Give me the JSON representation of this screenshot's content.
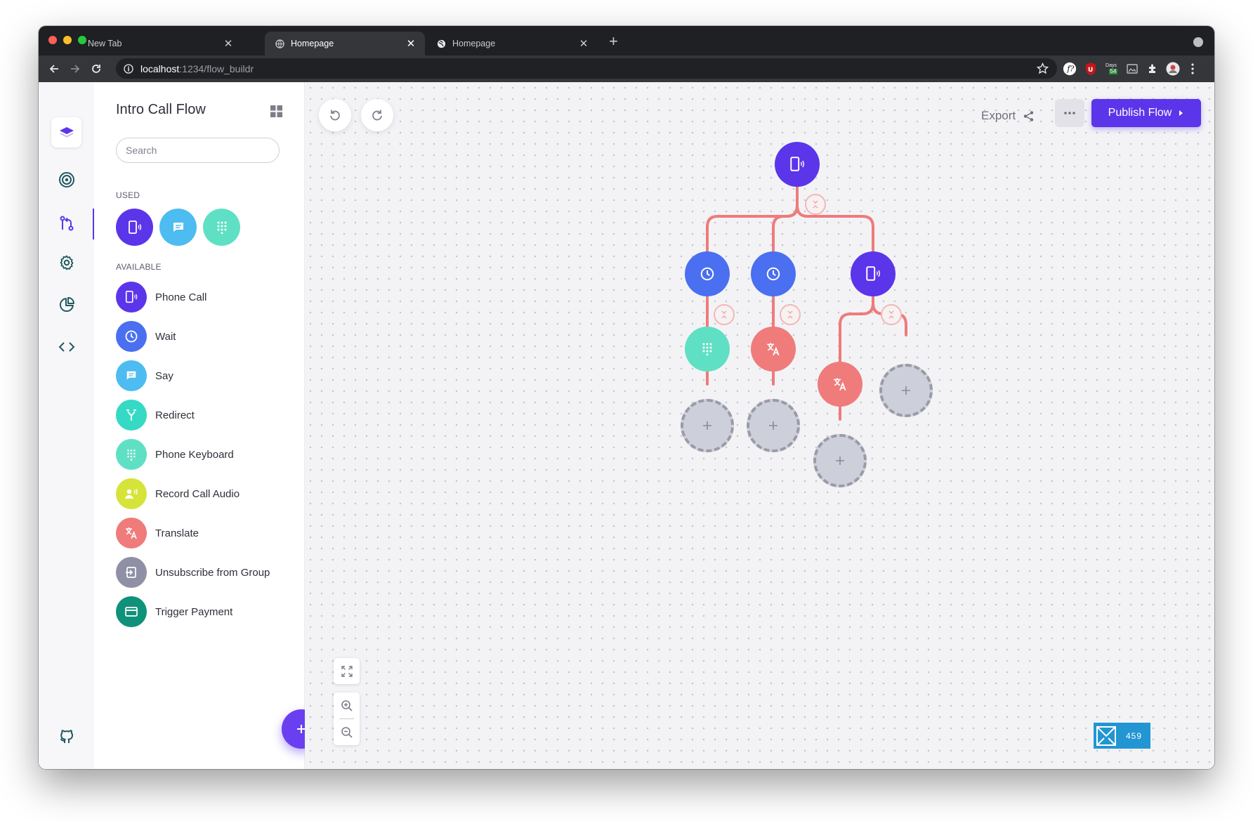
{
  "browser": {
    "tabs": [
      {
        "title": "New Tab",
        "active": false
      },
      {
        "title": "Homepage",
        "active": true
      },
      {
        "title": "Homepage",
        "active": false
      }
    ],
    "url_host": "localhost",
    "url_path": ":1234/flow_buildr",
    "extensions": {
      "days_label": "Days",
      "days_value": "54"
    }
  },
  "sidebar": {
    "title": "Intro Call Flow",
    "search_placeholder": "Search",
    "used_label": "USED",
    "available_label": "AVAILABLE",
    "used": [
      {
        "name": "phone",
        "color": "#5b35ea"
      },
      {
        "name": "say",
        "color": "#4dbcf0"
      },
      {
        "name": "keyboard",
        "color": "#5fe0c4"
      }
    ],
    "available": [
      {
        "label": "Phone Call",
        "color": "#5b35ea",
        "icon": "phone-icon"
      },
      {
        "label": "Wait",
        "color": "#4a6ff0",
        "icon": "clock-icon"
      },
      {
        "label": "Say",
        "color": "#4dbcf0",
        "icon": "chat-icon"
      },
      {
        "label": "Redirect",
        "color": "#35d9c4",
        "icon": "redirect-icon"
      },
      {
        "label": "Phone Keyboard",
        "color": "#5fe0c4",
        "icon": "keypad-icon"
      },
      {
        "label": "Record Call Audio",
        "color": "#d6e43a",
        "icon": "record-icon"
      },
      {
        "label": "Translate",
        "color": "#ef7b7b",
        "icon": "translate-icon"
      },
      {
        "label": "Unsubscribe from Group",
        "color": "#8f8fa5",
        "icon": "unsubscribe-icon"
      },
      {
        "label": "Trigger Payment",
        "color": "#10917a",
        "icon": "card-icon"
      }
    ]
  },
  "toolbar": {
    "export_label": "Export",
    "publish_label": "Publish Flow"
  },
  "badge": {
    "value": "459"
  },
  "colors": {
    "accent": "#5b35ea",
    "connector": "#ef7b7b",
    "canvas": "#f3f3f6"
  }
}
